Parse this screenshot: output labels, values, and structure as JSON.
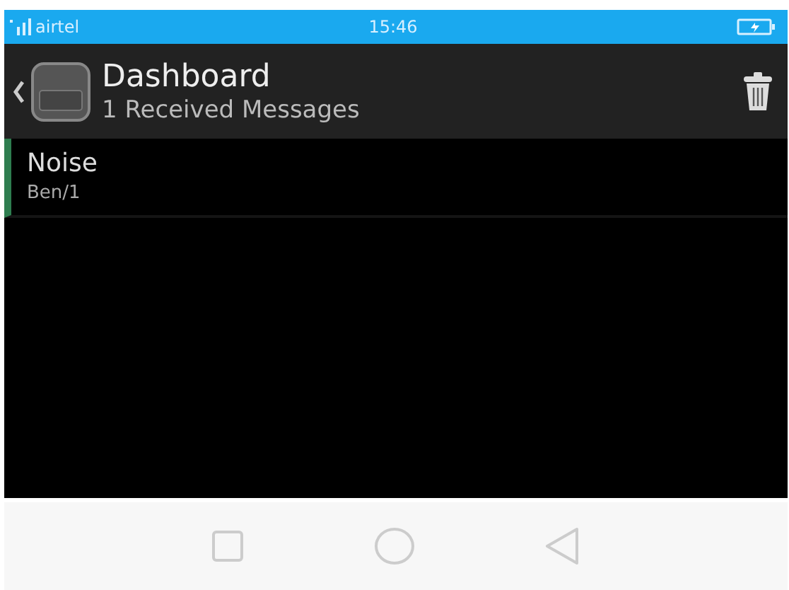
{
  "status_bar": {
    "carrier": "airtel",
    "time": "15:46"
  },
  "header": {
    "title": "Dashboard",
    "subtitle": "1 Received Messages"
  },
  "messages": [
    {
      "title": "Noise",
      "subtitle": "Ben/1",
      "selected": true
    }
  ]
}
